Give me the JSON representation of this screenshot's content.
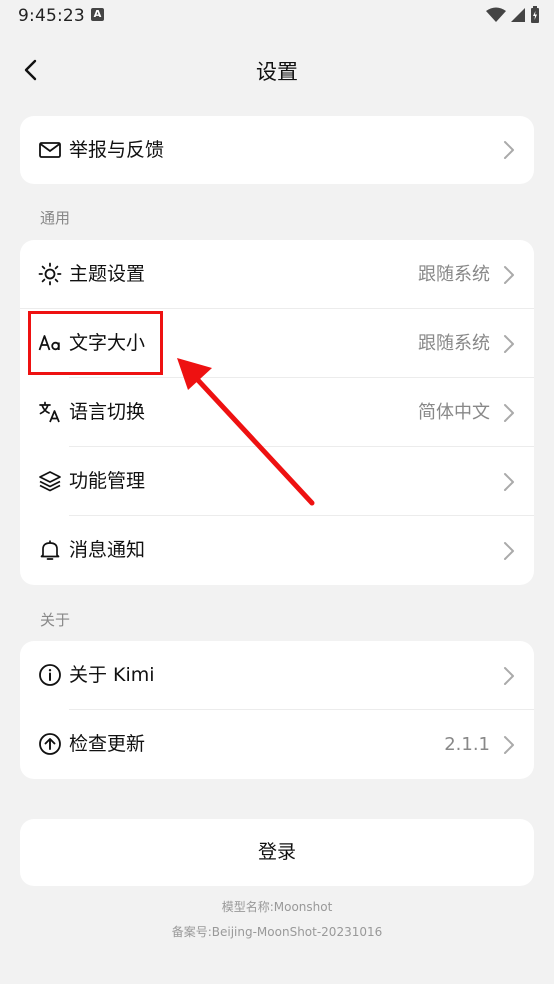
{
  "status_bar": {
    "time": "9:45:23",
    "notif_glyph": "A"
  },
  "header": {
    "title": "设置"
  },
  "feedback": {
    "label": "举报与反馈"
  },
  "general": {
    "section_title": "通用",
    "items": [
      {
        "label": "主题设置",
        "value": "跟随系统",
        "icon": "sun-icon"
      },
      {
        "label": "文字大小",
        "value": "跟随系统",
        "icon": "text-size-icon"
      },
      {
        "label": "语言切换",
        "value": "简体中文",
        "icon": "translate-icon"
      },
      {
        "label": "功能管理",
        "value": "",
        "icon": "layers-icon"
      },
      {
        "label": "消息通知",
        "value": "",
        "icon": "bell-icon"
      }
    ]
  },
  "about": {
    "section_title": "关于",
    "items": [
      {
        "label": "关于 Kimi",
        "value": "",
        "icon": "info-icon"
      },
      {
        "label": "检查更新",
        "value": "2.1.1",
        "icon": "upload-icon"
      }
    ]
  },
  "login": {
    "label": "登录"
  },
  "footer": {
    "model": "模型名称:Moonshot",
    "record": "备案号:Beijing-MoonShot-20231016"
  },
  "colors": {
    "highlight": "#ee1111",
    "background": "#f2f2f2",
    "card": "#ffffff",
    "secondary_text": "#888888"
  }
}
